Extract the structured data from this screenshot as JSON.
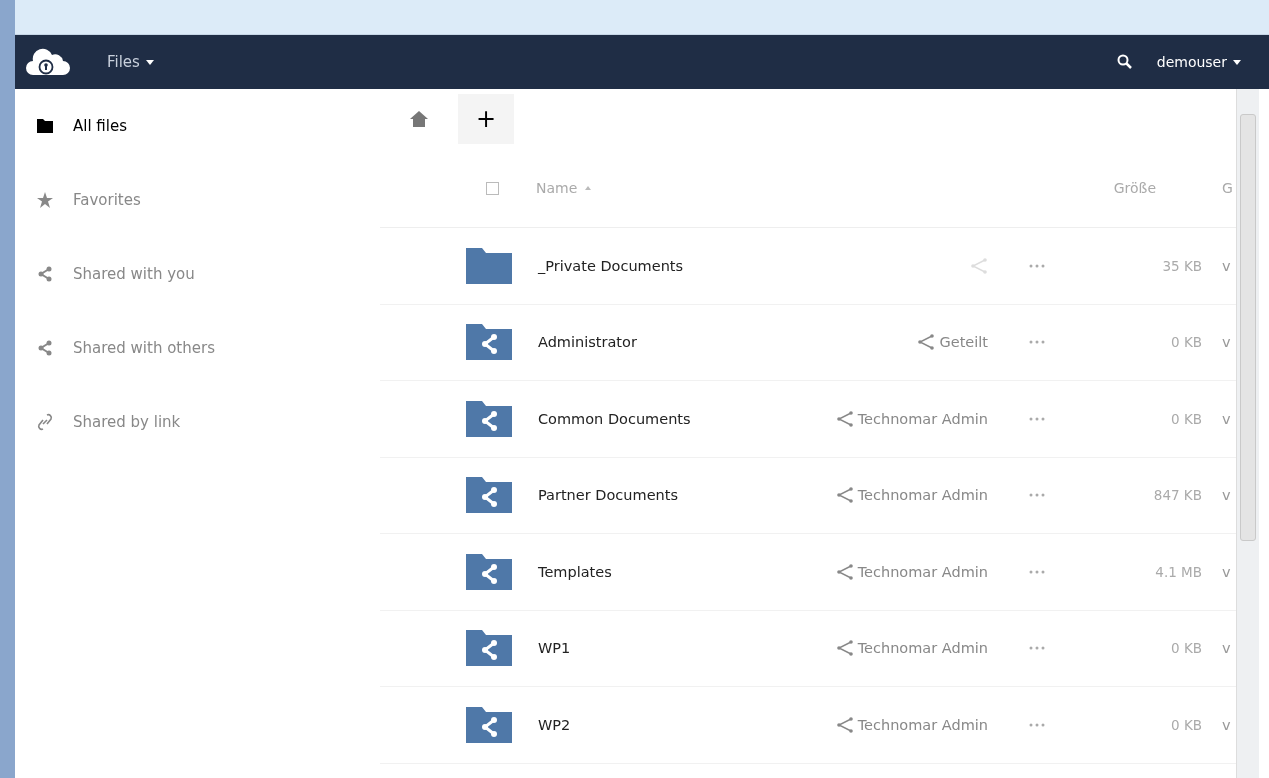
{
  "header": {
    "app_menu": "Files",
    "user": "demouser"
  },
  "sidebar": {
    "items": [
      {
        "label": "All files",
        "kind": "folder",
        "selected": true
      },
      {
        "label": "Favorites",
        "kind": "star",
        "selected": false
      },
      {
        "label": "Shared with you",
        "kind": "share",
        "selected": false
      },
      {
        "label": "Shared with others",
        "kind": "share",
        "selected": false
      },
      {
        "label": "Shared by link",
        "kind": "link",
        "selected": false
      }
    ]
  },
  "toolbar": {
    "new_button": "+"
  },
  "table": {
    "columns": [
      "Name",
      "Größe",
      "G"
    ],
    "select_all": false,
    "rows": [
      {
        "kind": "folder",
        "name": "_Private Documents",
        "share": "",
        "size": "35 KB",
        "column_3": "v"
      },
      {
        "kind": "shared",
        "name": "Administrator",
        "share": "Geteilt",
        "size": "0 KB",
        "column_3": "v"
      },
      {
        "kind": "shared",
        "name": "Common Documents",
        "share": "Technomar Admin",
        "size": "0 KB",
        "column_3": "v"
      },
      {
        "kind": "shared",
        "name": "Partner Documents",
        "share": "Technomar Admin",
        "size": "847 KB",
        "column_3": "v"
      },
      {
        "kind": "shared",
        "name": "Templates",
        "share": "Technomar Admin",
        "size": "4.1 MB",
        "column_3": "v"
      },
      {
        "kind": "shared",
        "name": "WP1",
        "share": "Technomar Admin",
        "size": "0 KB",
        "column_3": "v"
      },
      {
        "kind": "shared",
        "name": "WP2",
        "share": "Technomar Admin",
        "size": "0 KB",
        "column_3": "v"
      }
    ]
  }
}
